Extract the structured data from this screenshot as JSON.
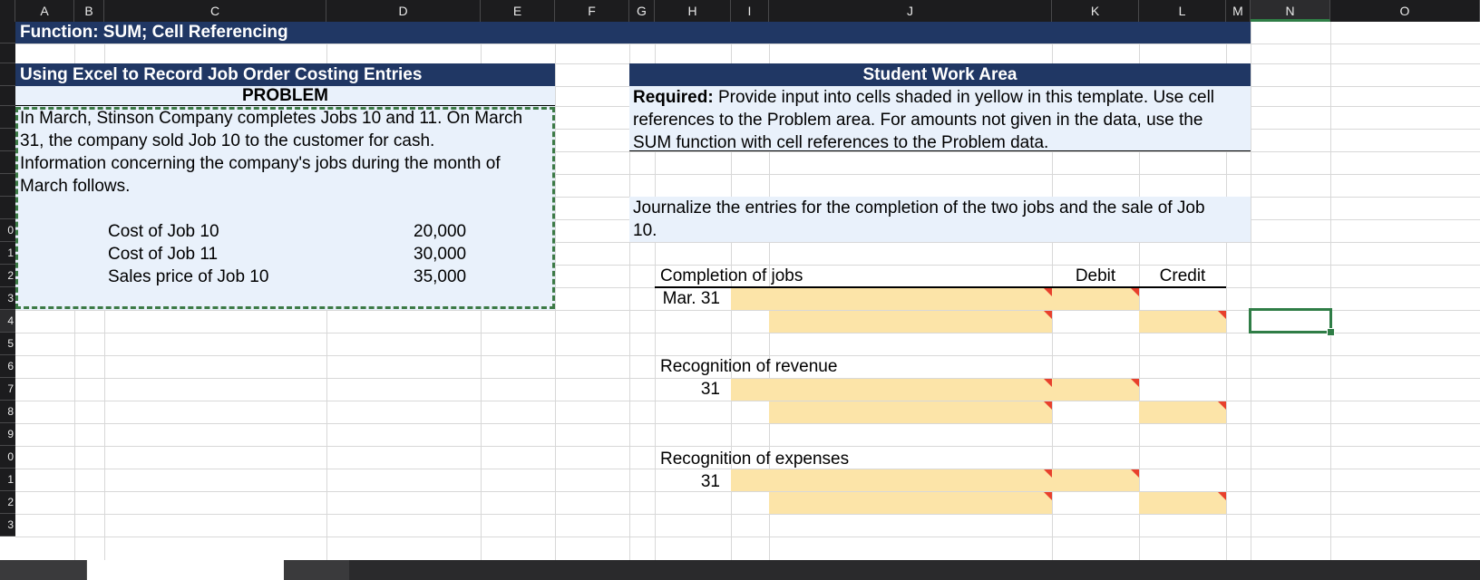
{
  "columns": [
    "A",
    "B",
    "C",
    "D",
    "E",
    "F",
    "G",
    "H",
    "I",
    "J",
    "K",
    "L",
    "M",
    "N",
    "O"
  ],
  "rows": [
    "",
    "",
    "",
    "",
    "",
    "",
    "",
    "",
    "",
    "0",
    "1",
    "2",
    "3",
    "4",
    "5",
    "6",
    "7",
    "8",
    "9",
    "0",
    "1",
    "2",
    "3"
  ],
  "title_bar": "Function: SUM; Cell Referencing",
  "problem": {
    "header": "Using Excel to Record Job Order Costing Entries",
    "subheader": "PROBLEM",
    "description": [
      "In March, Stinson Company completes Jobs 10 and 11. On March",
      "31, the company sold Job 10 to the customer for cash.",
      "Information concerning the company's jobs during the month of",
      "March follows."
    ],
    "items": [
      {
        "label": "Cost of Job 10",
        "value": "20,000"
      },
      {
        "label": "Cost of Job 11",
        "value": "30,000"
      },
      {
        "label": "Sales price of Job 10",
        "value": "35,000"
      }
    ]
  },
  "work_area": {
    "header": "Student Work Area",
    "required_label": "Required:",
    "required_lines": [
      " Provide input into cells shaded in yellow in this template. Use cell",
      "references to the Problem area. For amounts not given in the data, use the",
      "SUM function with cell references to the Problem data."
    ],
    "instruction_lines": [
      "Journalize the entries for the completion of the two jobs and the sale of Job",
      "10."
    ],
    "debit_label": "Debit",
    "credit_label": "Credit",
    "sections": [
      {
        "title": "Completion of jobs",
        "date": "Mar. 31"
      },
      {
        "title": "Recognition of revenue",
        "date": "31"
      },
      {
        "title": "Recognition of expenses",
        "date": "31"
      }
    ]
  },
  "colors": {
    "header_band": "#203764",
    "light_fill": "#e9f1fb",
    "input_fill": "#fce4a8",
    "selection": "#2f7d46",
    "comment_marker": "#e8402c"
  }
}
